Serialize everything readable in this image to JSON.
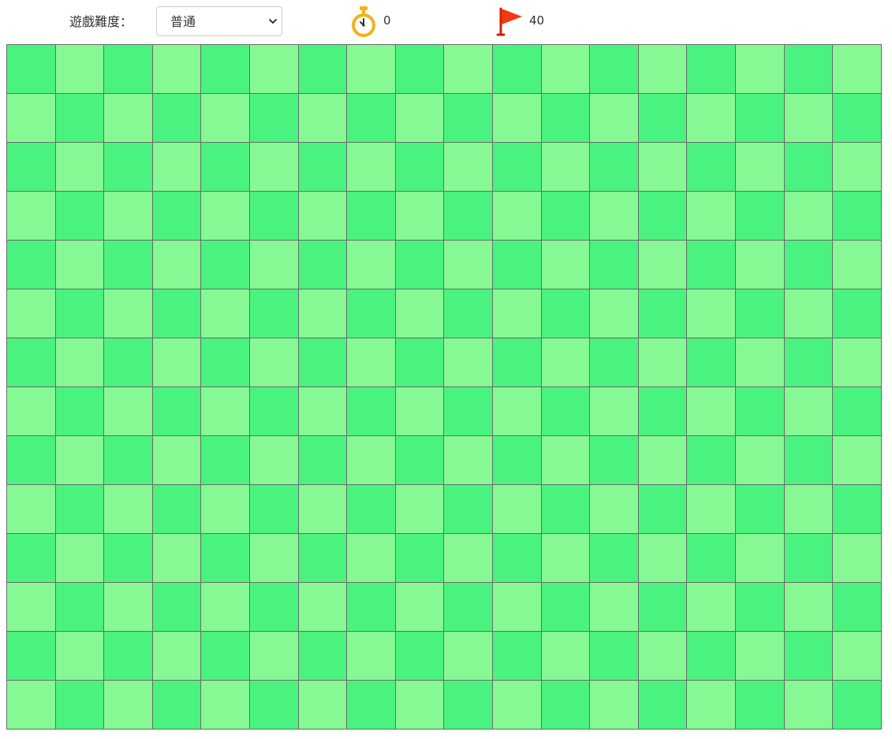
{
  "toolbar": {
    "difficulty_label": "遊戲難度：",
    "difficulty_selected": "普通",
    "timer_icon": "stopwatch-icon",
    "timer_value": "0",
    "flag_icon": "red-flag-icon",
    "flags_remaining": "40"
  },
  "board": {
    "rows": 14,
    "columns": 18,
    "state": "all cells unrevealed",
    "colors": {
      "cell_dark": "#4af37f",
      "cell_light": "#86f994",
      "grid_line": "#6b6b6b"
    }
  }
}
